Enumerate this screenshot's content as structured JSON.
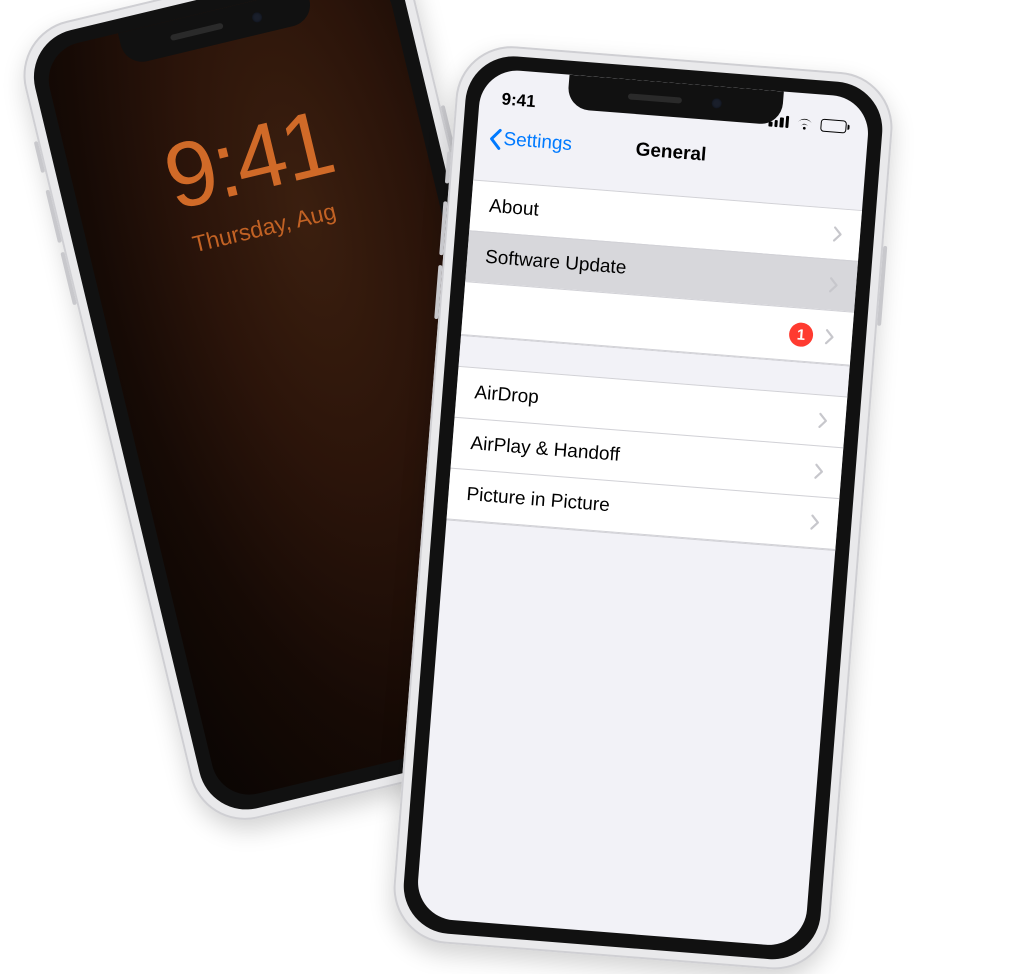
{
  "lockscreen": {
    "time": "9:41",
    "date": "Thursday, Aug"
  },
  "status": {
    "time": "9:41"
  },
  "nav": {
    "back_label": "Settings",
    "title": "General"
  },
  "general": {
    "about": "About",
    "software_update": "Software Update",
    "badge_count": "1",
    "airdrop": "AirDrop",
    "airplay_handoff": "AirPlay & Handoff",
    "pip": "Picture in Picture"
  },
  "colors": {
    "ios_blue": "#007aff",
    "badge_red": "#ff3b30"
  }
}
